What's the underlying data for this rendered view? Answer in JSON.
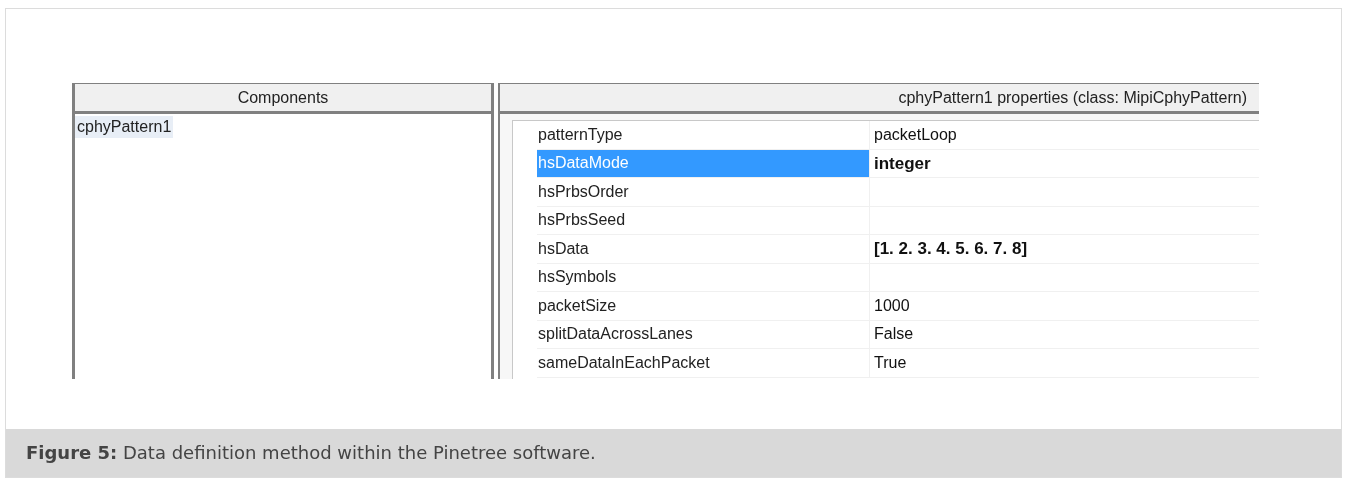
{
  "components_panel": {
    "title": "Components",
    "items": [
      {
        "label": "cphyPattern1",
        "selected": true
      }
    ]
  },
  "properties_panel": {
    "title": "cphyPattern1 properties (class: MipiCphyPattern)",
    "rows": [
      {
        "name": "patternType",
        "value": "packetLoop",
        "selected": false,
        "modified": false
      },
      {
        "name": "hsDataMode",
        "value": "integer",
        "selected": true,
        "modified": true
      },
      {
        "name": "hsPrbsOrder",
        "selected": false
      },
      {
        "name": "hsPrbsSeed",
        "selected": false
      },
      {
        "name": "hsData",
        "value": "[1. 2. 3. 4. 5. 6. 7. 8]",
        "selected": false,
        "modified": true
      },
      {
        "name": "hsSymbols",
        "selected": false
      },
      {
        "name": "packetSize",
        "value": "1000",
        "selected": false,
        "modified": false
      },
      {
        "name": "splitDataAcrossLanes",
        "value": "False",
        "selected": false,
        "modified": false
      },
      {
        "name": "sameDataInEachPacket",
        "value": "True",
        "selected": false,
        "modified": false
      }
    ]
  },
  "caption": "**Figure 5:** Data definition method within the Pinetree software."
}
